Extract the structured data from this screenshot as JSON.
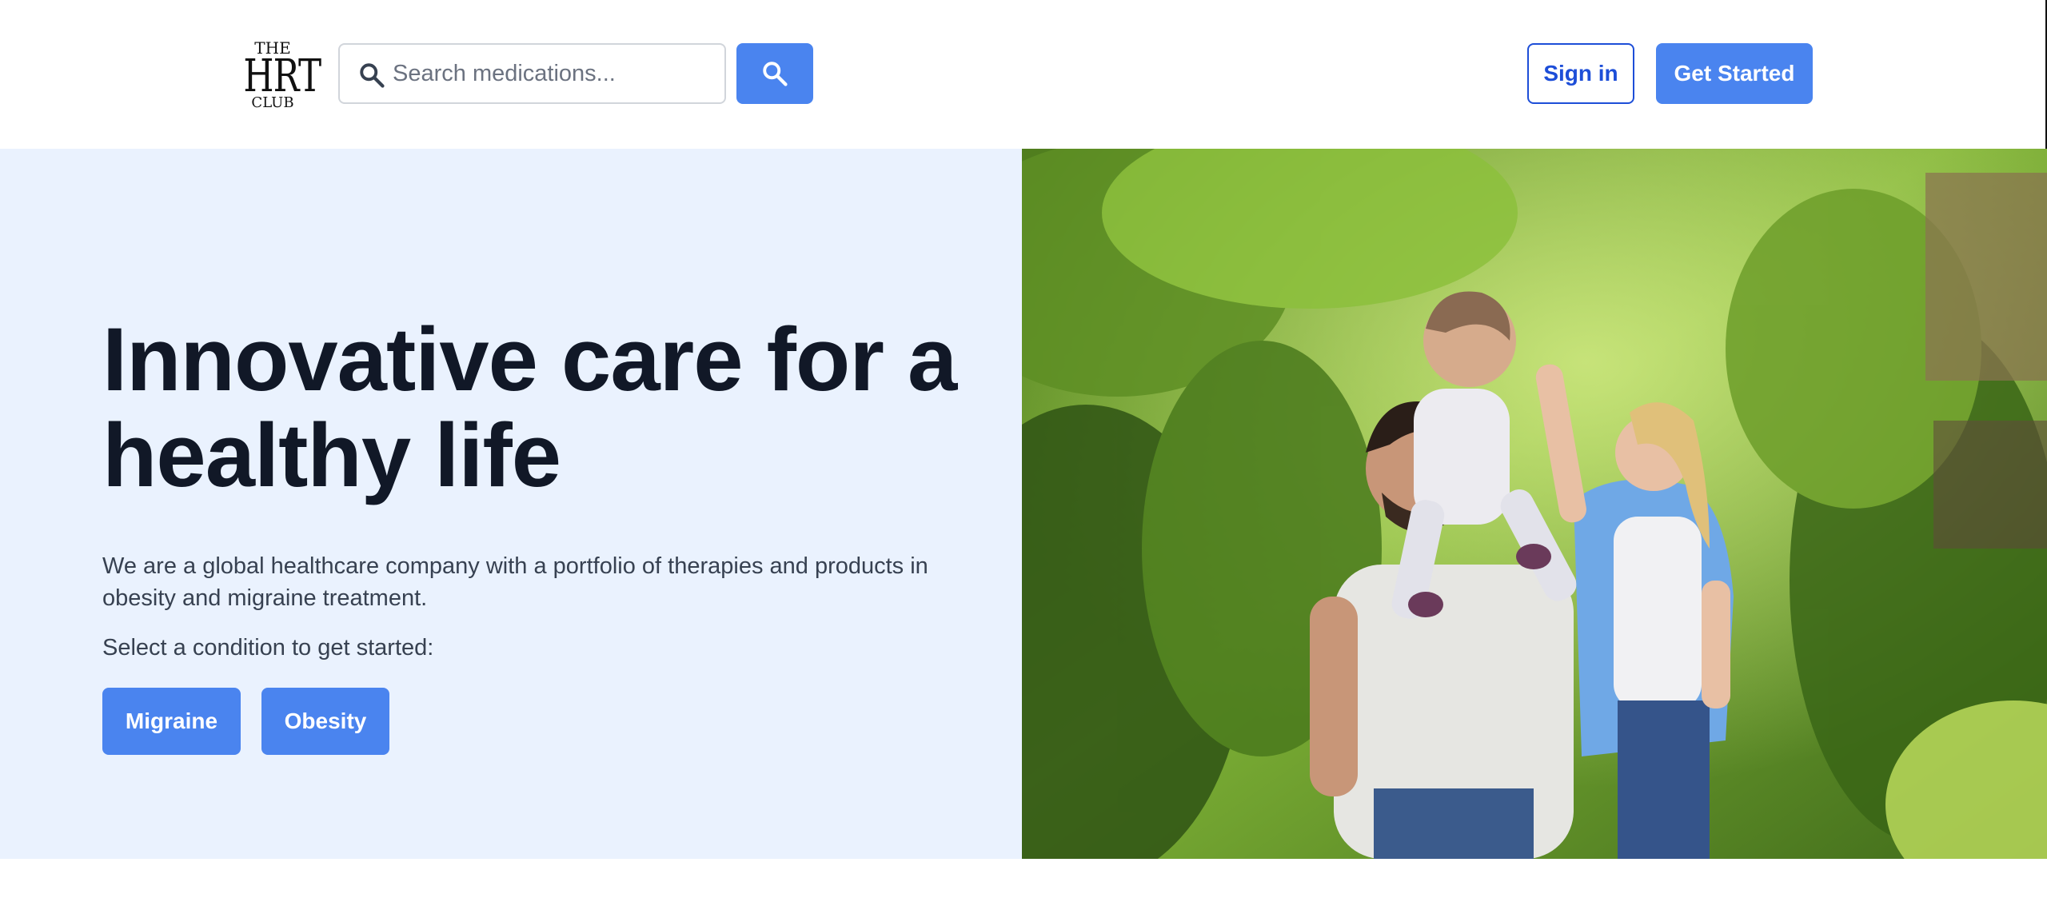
{
  "header": {
    "logo": {
      "line1": "THE",
      "line2": "HRT",
      "line3": "CLUB"
    },
    "search": {
      "placeholder": "Search medications...",
      "icon": "search-icon",
      "button_icon": "search-icon"
    },
    "sign_in_label": "Sign in",
    "get_started_label": "Get Started"
  },
  "hero": {
    "title": "Innovative care for a healthy life",
    "description": "We are a global healthcare company with a portfolio of therapies and products in obesity and migraine treatment.",
    "select_prompt": "Select a condition to get started:",
    "conditions": [
      {
        "label": "Migraine"
      },
      {
        "label": "Obesity"
      }
    ],
    "image_alt": "Family walking outdoors in a green garden"
  },
  "colors": {
    "accent": "#4a84ef",
    "outline": "#1d4ed8",
    "hero_bg": "#eaf2fe",
    "text_dark": "#111827",
    "text_body": "#374151"
  }
}
